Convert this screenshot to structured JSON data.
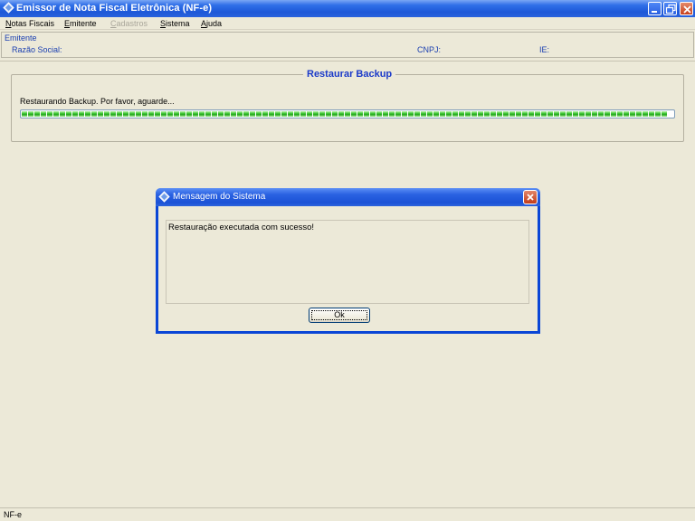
{
  "window": {
    "title": "Emissor de Nota Fiscal Eletrônica (NF-e)"
  },
  "menubar": {
    "items": [
      {
        "label": "Notas Fiscais",
        "disabled": false
      },
      {
        "label": "Emitente",
        "disabled": false
      },
      {
        "label": "Cadastros",
        "disabled": true
      },
      {
        "label": "Sistema",
        "disabled": false
      },
      {
        "label": "Ajuda",
        "disabled": false
      }
    ]
  },
  "emitente": {
    "legend": "Emitente",
    "razao_social_label": "Razão Social:",
    "cnpj_label": "CNPJ:",
    "ie_label": "IE:"
  },
  "restore": {
    "title": "Restaurar Backup",
    "status": "Restaurando Backup. Por favor, aguarde...",
    "progress": 1.0
  },
  "dialog": {
    "title": "Mensagem do Sistema",
    "message": "Restauração executada com sucesso!",
    "ok_label": "Ok"
  },
  "statusbar": {
    "text": "NF-e"
  },
  "colors": {
    "titlebar": "#1d58d8",
    "progress_green": "#33c22a",
    "group_title": "#1b3ac9",
    "label_blue": "#1a3fb0"
  },
  "icons": [
    "app-icon",
    "minimize-icon",
    "restore-icon",
    "close-icon"
  ]
}
